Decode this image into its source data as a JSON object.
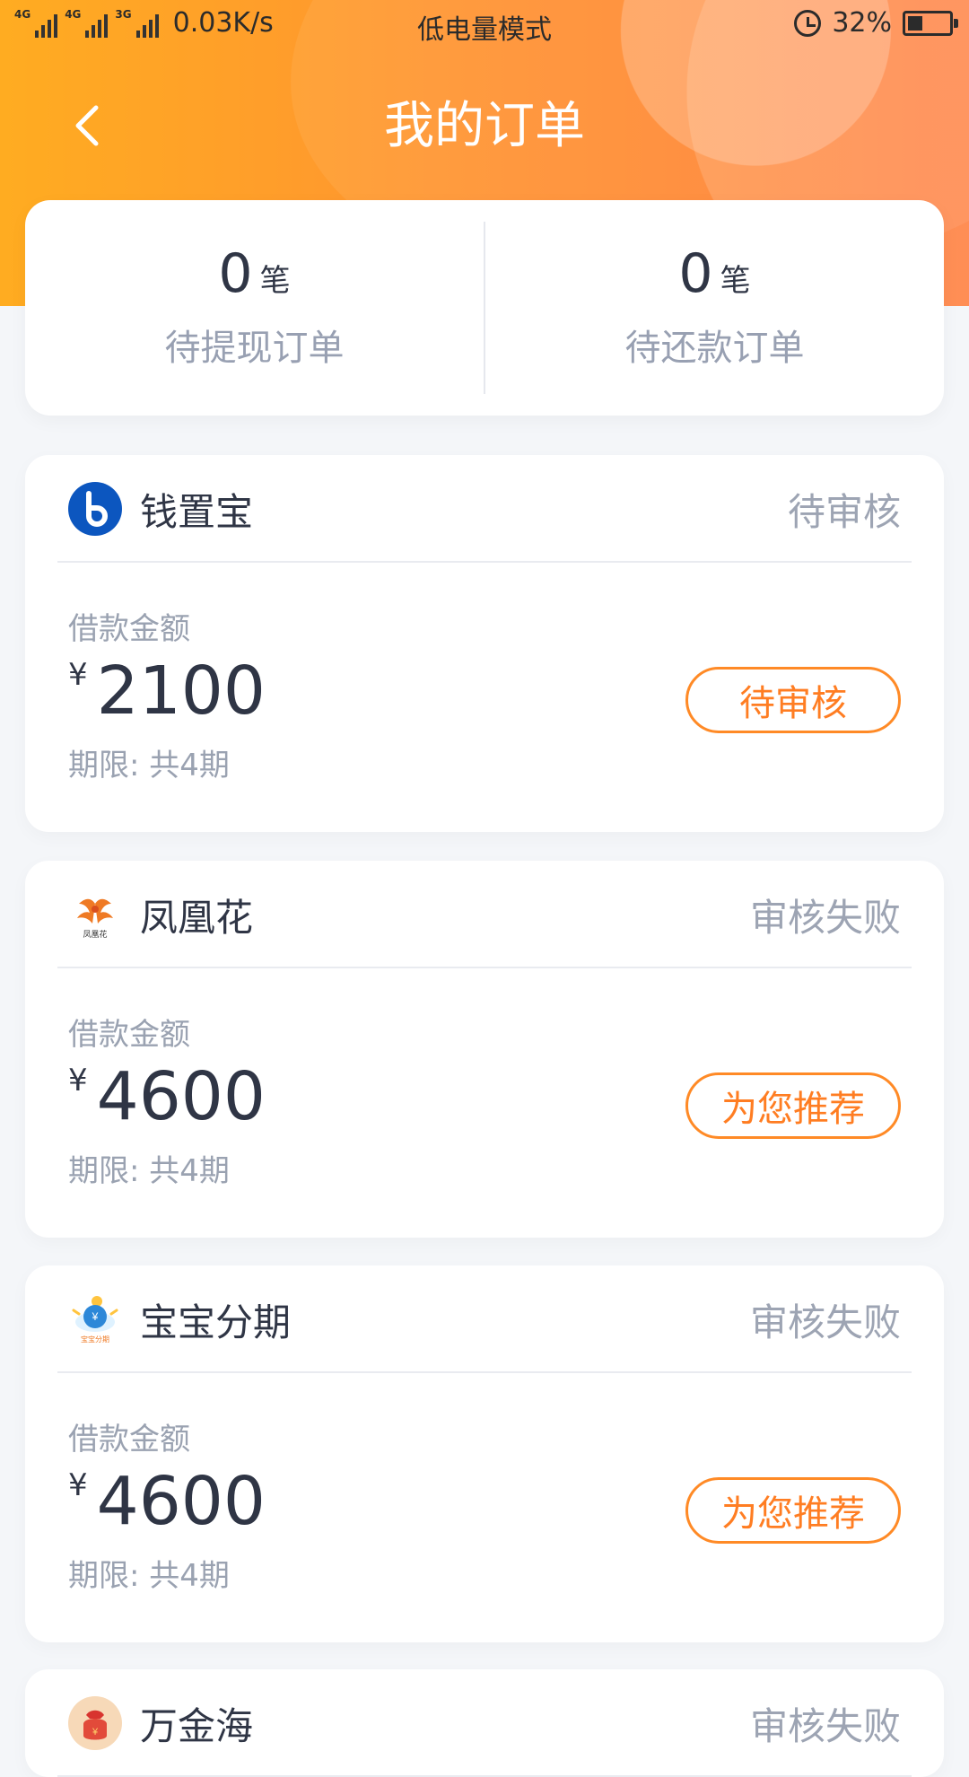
{
  "status_bar": {
    "network_1": "4G",
    "network_2": "4G",
    "network_3": "3G",
    "speed": "0.03K/s",
    "mode": "低电量模式",
    "battery": "32%",
    "battery_level": 0.32
  },
  "header": {
    "title": "我的订单"
  },
  "summary": {
    "left_count": "0",
    "left_unit": "笔",
    "left_label": "待提现订单",
    "right_count": "0",
    "right_unit": "笔",
    "right_label": "待还款订单"
  },
  "orders": [
    {
      "brand": "钱置宝",
      "status": "待审核",
      "amount_label": "借款金额",
      "currency": "¥",
      "amount": "2100",
      "term": "期限: 共4期",
      "button": "待审核",
      "icon": "brand-b-icon"
    },
    {
      "brand": "凤凰花",
      "status": "审核失败",
      "amount_label": "借款金额",
      "currency": "¥",
      "amount": "4600",
      "term": "期限: 共4期",
      "button": "为您推荐",
      "icon": "phoenix-icon",
      "icon_text": "凤凰花"
    },
    {
      "brand": "宝宝分期",
      "status": "审核失败",
      "amount_label": "借款金额",
      "currency": "¥",
      "amount": "4600",
      "term": "期限: 共4期",
      "button": "为您推荐",
      "icon": "baby-installment-icon",
      "icon_text": "宝宝分期"
    },
    {
      "brand": "万金海",
      "status": "审核失败",
      "icon": "money-bag-icon"
    }
  ]
}
